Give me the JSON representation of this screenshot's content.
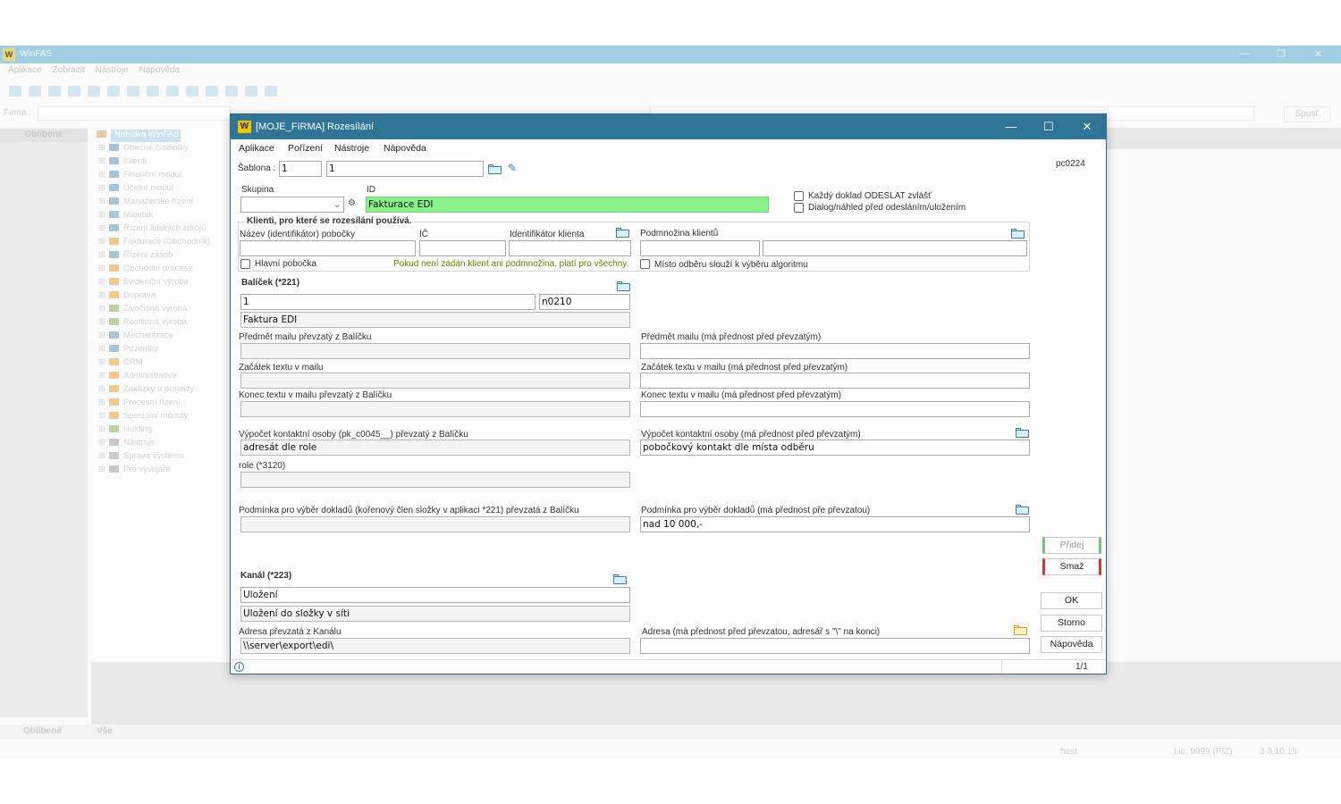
{
  "background": {
    "title": "WinFAS",
    "menu": [
      "Aplikace",
      "Zobrazit",
      "Nástroje",
      "Nápověda"
    ],
    "firma_label": "Firma :",
    "spust_label": "Spusť",
    "left_header": "Oblíbené",
    "tree_root": "Nabídka WinFAS",
    "tree_items": [
      "Obecné číselníky",
      "Klienti",
      "Finanční modul",
      "Účetní modul",
      "Manažerské řízení",
      "Majetek",
      "Řízení lidských zdrojů",
      "Fakturace (Obchodník)",
      "Řízení zásob",
      "Obchodní procesy",
      "Evidenční výroba",
      "Doprava",
      "Živočišná výroba",
      "Rostlinná výroba",
      "Mechanizace",
      "Pozemky",
      "CRM",
      "Administrativa",
      "Zakázky a projekty",
      "Procesní řízení",
      "Speciální moduly",
      "Holding",
      "Nástroje",
      "Správa systému",
      "Pro vývojáře"
    ],
    "bottom_tabs": [
      "Oblíbené",
      "Vše"
    ],
    "status_user": "host",
    "status_lic": "Lic: 9999 (P/Z)",
    "status_version": "3.3.10.15"
  },
  "dialog": {
    "title": "[MOJE_FIRMA] Rozesílání",
    "menu": [
      "Aplikace",
      "Pořízení",
      "Nástroje",
      "Nápověda"
    ],
    "sablona_label": "Šablona :",
    "sablona_value1": "1",
    "sablona_value2": "1",
    "code": "pc0224",
    "skupina_label": "Skupina",
    "id_label": "ID",
    "id_value": "Fakturace EDI",
    "check_odeslat": "Každý doklad ODESLAT zvlášť",
    "check_dialog": "Dialog/náhled před odesláním/uložením",
    "clients_group": "Klienti, pro které se rozesílání používá.",
    "nazev_label": "Název (identifikátor) pobočky",
    "ic_label": "IČ",
    "ident_label": "Identifikátor klienta",
    "podmnozina_label": "Podmnožina klientů",
    "hlavni_pobocka": "Hlavní pobočka",
    "warning": "Pokud není zadán klient ani podmnožina, platí pro všechny.",
    "misto_odberu": "Místo odběru slouží k výběru algoritmu",
    "balicek_label": "Balíček (*221)",
    "balicek_value": "1",
    "balicek_code": "n0210",
    "balicek_name": "Faktura EDI",
    "predmet_left_label": "Předmět mailu převzatý z Balíčku",
    "predmet_right_label": "Předmět mailu (má přednost před převzatým)",
    "zacatek_left_label": "Začátek textu v mailu",
    "zacatek_right_label": "Začátek textu v mailu (má přednost před převzatým)",
    "konec_left_label": "Konec textu v mailu převzatý z Balíčku",
    "konec_right_label": "Konec textu v mailu (má přednost před převzatým)",
    "vypocet_left_label": "Výpočet kontaktní osoby (pk_c0045__) převzatý z Balíčku",
    "vypocet_left_value": "adresát dle role",
    "vypocet_right_label": "Výpočet kontaktní osoby (má přednost před převzatým)",
    "vypocet_right_value": "pobočkový kontakt dle místa odběru",
    "role_label": "role (*3120)",
    "podminka_left_label": "Podmínka pro výběr dokladů (kořenový člen složky v aplikaci *221) převzatá z Balíčku",
    "podminka_right_label": "Podmínka pro výběr dokladů (má přednost pře převzatou)",
    "podminka_right_value": "nad 10 000,-",
    "kanal_label": "Kanál (*223)",
    "kanal_value": "Uložení",
    "kanal_name": "Uložení do složky v síti",
    "adresa_left_label": "Adresa převzatá z Kanálu",
    "adresa_left_value": "\\\\server\\export\\edi\\",
    "adresa_right_label": "Adresa (má přednost před převzatou, adresář s \"\\\" na konci)",
    "btn_pridej": "Přidej",
    "btn_smaz": "Smaž",
    "btn_ok": "OK",
    "btn_storno": "Storno",
    "btn_napoveda": "Nápověda",
    "status_page": "1/1",
    "accent": "#2e7596",
    "id_highlight": "#8af08a"
  }
}
